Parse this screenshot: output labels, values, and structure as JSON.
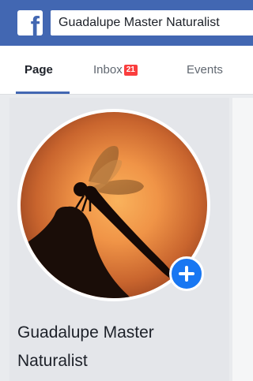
{
  "header": {
    "logo_letter": "f",
    "search_value": "Guadalupe Master Naturalist"
  },
  "tabs": [
    {
      "label": "Page",
      "active": true
    },
    {
      "label": "Inbox",
      "badge": "21"
    },
    {
      "label": "Events"
    }
  ],
  "profile": {
    "name": "Guadalupe Master Naturalist",
    "photo_subject": "dragonfly silhouette at sunset"
  },
  "icons": {
    "logo": "facebook-logo-icon",
    "add_photo": "plus-icon"
  },
  "colors": {
    "brand": "#4267b2",
    "badge": "#fa3e3e",
    "add_button": "#1877f2"
  }
}
